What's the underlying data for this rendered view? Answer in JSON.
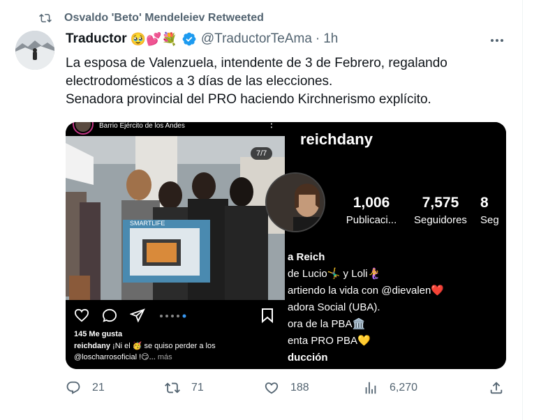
{
  "retweet": {
    "text": "Osvaldo 'Beto' Mendeleiev Retweeted"
  },
  "author": {
    "name": "Traductor",
    "emojis": "🥹💕💐",
    "handle": "@TraductorTeAma",
    "separator": "·",
    "time": "1h"
  },
  "tweet": {
    "lines": [
      "La esposa de Valenzuela, intendente de 3 de Febrero, regalando",
      "electrodomésticos a 3 días de las elecciones.",
      "Senadora provincial del PRO haciendo Kirchnerismo explícito."
    ]
  },
  "media_left": {
    "location": "Barrio Ejército de los Andes",
    "counter": "7/7",
    "box_brand": "SMARTLIFE",
    "likes": "145 Me gusta",
    "caption_user": "reichdany",
    "caption_text": " ¡Ni el 🥳 se quiso perder a los",
    "caption_line2": "@loscharrosoficial !😏...",
    "caption_more": " más"
  },
  "media_right": {
    "username": "reichdany",
    "stats": [
      {
        "num": "1,006",
        "label": "Publicaci..."
      },
      {
        "num": "7,575",
        "label": "Seguidores"
      },
      {
        "num": "8",
        "label": "Seg"
      }
    ],
    "bio": [
      "a Reich",
      " de Lucio🤸‍♂️ y Loli🧜‍♀️",
      "artiendo la vida con @dievalen❤️",
      "adora Social (UBA).",
      "ora de la PBA🏛️",
      "enta PRO PBA💛",
      "ducción"
    ]
  },
  "stats": {
    "replies": "21",
    "retweets": "71",
    "likes": "188",
    "views": "6,270"
  },
  "colors": {
    "text": "#0f1419",
    "secondary": "#536471",
    "verified": "#1d9bf0"
  }
}
